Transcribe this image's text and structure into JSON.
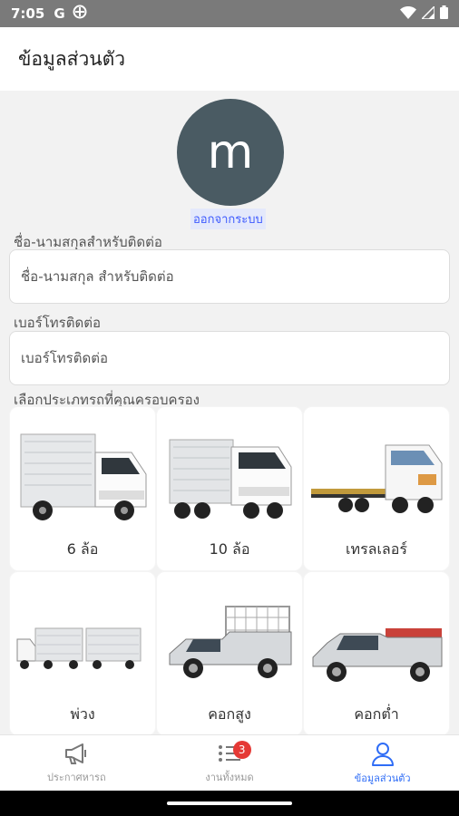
{
  "status_bar": {
    "time": "7:05",
    "left_icons": [
      "google-icon",
      "vpn-icon"
    ],
    "right_icons": [
      "wifi-icon",
      "signal-icon",
      "battery-icon"
    ]
  },
  "app_bar": {
    "title": "ข้อมูลส่วนตัว"
  },
  "profile": {
    "avatar_letter": "m",
    "logout_label": "ออกจากระบบ"
  },
  "form": {
    "name_label": "ชื่อ-นามสกุลสำหรับติดต่อ",
    "name_placeholder": "ชื่อ-นามสกุล สำหรับติดต่อ",
    "name_value": "",
    "phone_label": "เบอร์โทรติดต่อ",
    "phone_placeholder": "เบอร์โทรติดต่อ",
    "phone_value": "",
    "truck_type_label": "เลือกประเภทรถที่คุณครอบครอง"
  },
  "truck_types": [
    {
      "label": "6 ล้อ",
      "icon": "six-wheel-truck-icon"
    },
    {
      "label": "10 ล้อ",
      "icon": "ten-wheel-truck-icon"
    },
    {
      "label": "เทรลเลอร์",
      "icon": "trailer-truck-icon"
    },
    {
      "label": "พ่วง",
      "icon": "truck-with-trailer-icon"
    },
    {
      "label": "คอกสูง",
      "icon": "pickup-high-cage-icon"
    },
    {
      "label": "คอกต่ำ",
      "icon": "pickup-low-cage-icon"
    }
  ],
  "bottom_nav": {
    "items": [
      {
        "label": "ประกาศหารถ",
        "icon": "megaphone-icon",
        "active": false
      },
      {
        "label": "งานทั้งหมด",
        "icon": "list-icon",
        "active": false,
        "badge": "3"
      },
      {
        "label": "ข้อมูลส่วนตัว",
        "icon": "person-icon",
        "active": true
      }
    ]
  },
  "colors": {
    "accent": "#2f6df6",
    "badge": "#e53935",
    "avatar_bg": "#4a5b63",
    "status_bar": "#7a7a7a"
  }
}
